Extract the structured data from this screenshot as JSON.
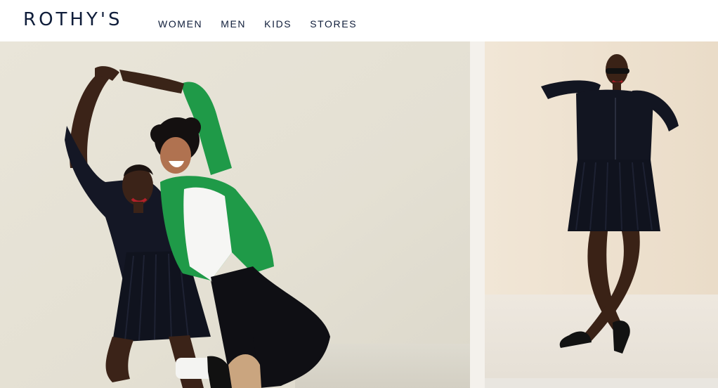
{
  "brand": {
    "logo_text": "ROTHY'S",
    "text_color": "#0f1d3a"
  },
  "nav": {
    "items": [
      {
        "label": "WOMEN"
      },
      {
        "label": "MEN"
      },
      {
        "label": "KIDS"
      },
      {
        "label": "STORES"
      }
    ]
  },
  "colors": {
    "left_backdrop": "#e6e2d6",
    "right_backdrop": "#efe3d2",
    "cardigan_green": "#1f9a48",
    "navy_outfit": "#121521",
    "white_top": "#f6f6f4",
    "tan_shoe": "#caa57f"
  }
}
